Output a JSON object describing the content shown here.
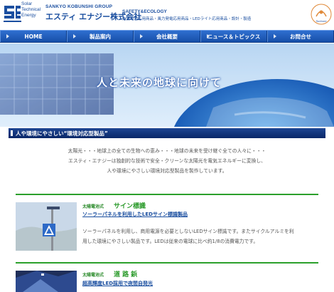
{
  "header": {
    "logo_abbr": "SE",
    "logo_sub": [
      "Solar",
      "Technical",
      "Energy"
    ],
    "group": "SANKYO KOBUNSHI GROUP",
    "company": "エスティ エナジー株式会社",
    "safety": "SAFETY&ECOLOGY",
    "tagline": "太陽電池応用商品・風力発電応用商品・LEDライト応用商品・設計・製造",
    "side_logo_text": "Sunhore"
  },
  "nav": {
    "items": [
      {
        "label": "HOME"
      },
      {
        "label": "製品案内"
      },
      {
        "label": "会社概要"
      },
      {
        "label": "ニュース＆トピックス"
      },
      {
        "label": "お問合せ"
      }
    ]
  },
  "hero": {
    "text": "人と未来の地球に向けて"
  },
  "section": {
    "title": "人や環境にやさしい“環境対応型製品”"
  },
  "intro": {
    "lines": [
      "太陽光・・・地球上の全ての生物への恵み・・・地球の未来を受け継ぐ全ての人々に・・・",
      "エスティ・エナジーは独創的な技術で安全・クリーンな太陽光を電気エネルギーに変換し、",
      "人や環境にやさしい環境対応型製品を製作しています。"
    ]
  },
  "products": [
    {
      "kind": "太陽電池式",
      "name": "サイン標識",
      "link": "ソーラーパネルを利用したLEDサイン標識製品",
      "desc": [
        "ソーラーパネルを利用し、商用電源を必要としないLEDサイン標識です。またサイクルアルミを利",
        "用した環境にやさしい製品です。LEDは従来の電球に比べ約1/8の消費電力です。"
      ]
    },
    {
      "kind": "太陽電池式",
      "name": "道 路 鋲",
      "link": "超高輝度LED採用で夜間自発光",
      "desc": []
    }
  ],
  "colors": {
    "brand_blue": "#1b4fa0",
    "nav_blue": "#2f6fd0",
    "accent_green": "#2a9a2a"
  }
}
